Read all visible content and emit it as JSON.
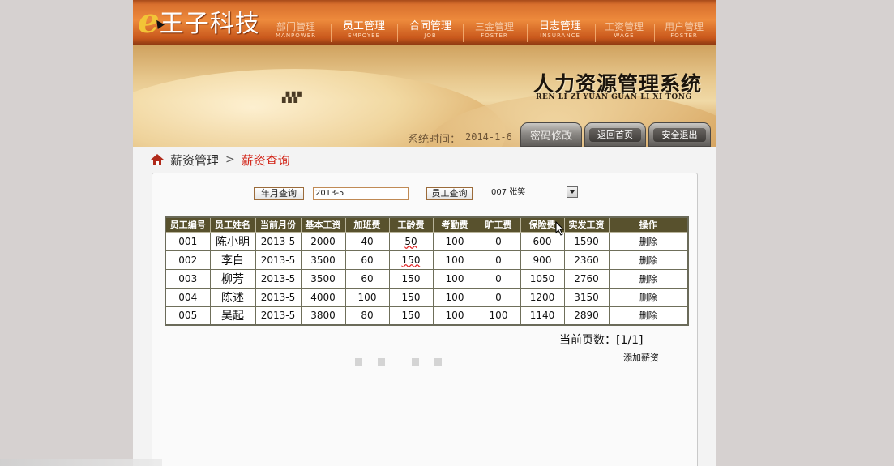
{
  "logo": {
    "mark": "e",
    "text": "王子科技"
  },
  "nav": [
    {
      "label": "部门管理",
      "sub": "MANPOWER",
      "dim": true
    },
    {
      "label": "员工管理",
      "sub": "EMPOYEE",
      "dim": false
    },
    {
      "label": "合同管理",
      "sub": "JOB",
      "dim": false
    },
    {
      "label": "三金管理",
      "sub": "FOSTER",
      "dim": true
    },
    {
      "label": "日志管理",
      "sub": "INSURANCE",
      "dim": false
    },
    {
      "label": "工资管理",
      "sub": "WAGE",
      "dim": true
    },
    {
      "label": "用户管理",
      "sub": "FOSTER",
      "dim": true
    }
  ],
  "banner": {
    "title": "人力资源管理系统",
    "subtitle": "REN LI ZI YUAN GUAN LI XI TONG",
    "time_label": "系统时间：",
    "time_value": "2014-1-6",
    "buttons": {
      "password": "密码修改",
      "home": "返回首页",
      "logout": "安全退出"
    }
  },
  "breadcrumb": {
    "parent": "薪资管理",
    "sep": ">",
    "current": "薪资查询"
  },
  "search": {
    "month_button": "年月查询",
    "month_value": "2013-5",
    "employee_button": "员工查询",
    "employee_selected": "007  张笑"
  },
  "table": {
    "headers": [
      "员工编号",
      "员工姓名",
      "当前月份",
      "基本工资",
      "加班费",
      "工龄费",
      "考勤费",
      "旷工费",
      "保险费",
      "实发工资",
      "操作"
    ],
    "rows": [
      [
        "001",
        "陈小明",
        "2013-5",
        "2000",
        "40",
        "50",
        "100",
        "0",
        "600",
        "1590",
        "删除"
      ],
      [
        "002",
        "李白",
        "2013-5",
        "3500",
        "60",
        "150",
        "100",
        "0",
        "900",
        "2360",
        "删除"
      ],
      [
        "003",
        "柳芳",
        "2013-5",
        "3500",
        "60",
        "150",
        "100",
        "0",
        "1050",
        "2760",
        "删除"
      ],
      [
        "004",
        "陈述",
        "2013-5",
        "4000",
        "100",
        "150",
        "100",
        "0",
        "1200",
        "3150",
        "删除"
      ],
      [
        "005",
        "吴起",
        "2013-5",
        "3800",
        "80",
        "150",
        "100",
        "100",
        "1140",
        "2890",
        "删除"
      ]
    ]
  },
  "pagination": {
    "label": "当前页数：[1/1]"
  },
  "actions": {
    "add": "添加薪资"
  },
  "colors": {
    "nav_orange": "#ed8a3c",
    "header_olive": "#58512d",
    "breadcrumb_red": "#d11d10"
  }
}
